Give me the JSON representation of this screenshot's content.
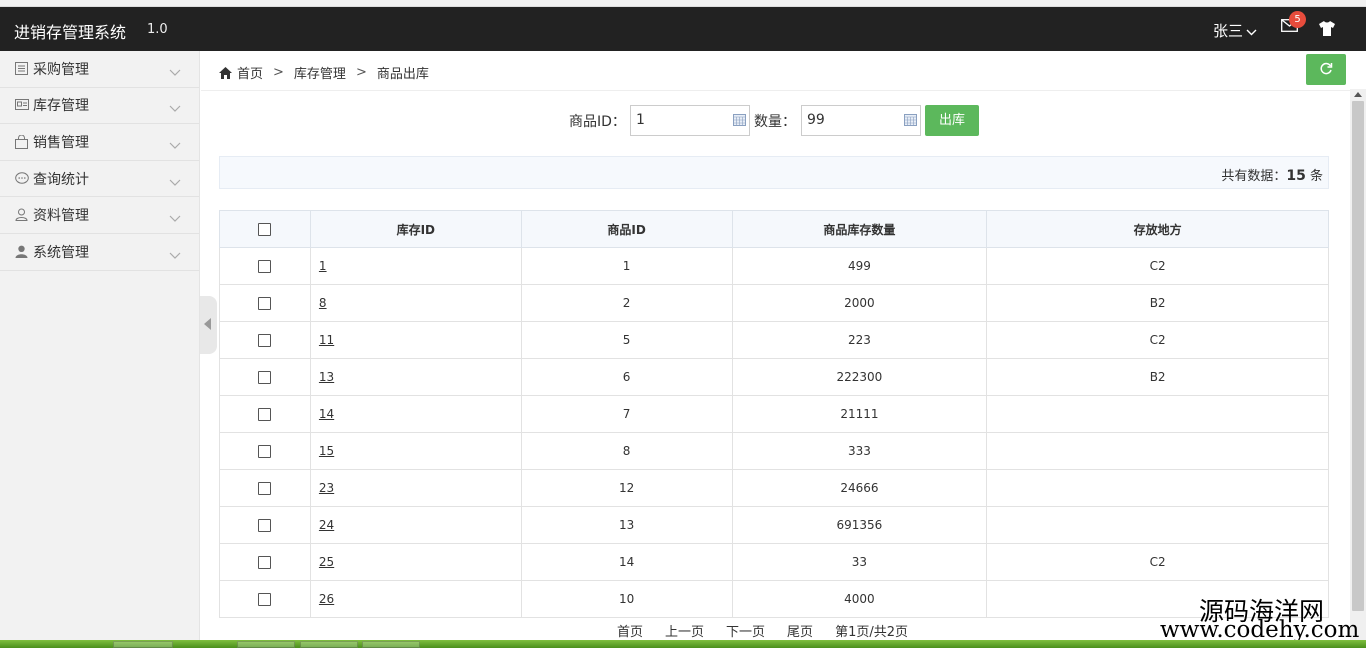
{
  "app": {
    "title": "进销存管理系统",
    "version": "1.0"
  },
  "header": {
    "user": "张三",
    "mail_badge": "5"
  },
  "sidebar": {
    "items": [
      {
        "label": "采购管理",
        "icon": "list-icon"
      },
      {
        "label": "库存管理",
        "icon": "card-icon"
      },
      {
        "label": "销售管理",
        "icon": "bag-icon"
      },
      {
        "label": "查询统计",
        "icon": "chat-icon"
      },
      {
        "label": "资料管理",
        "icon": "user-outline-icon"
      },
      {
        "label": "系统管理",
        "icon": "user-solid-icon"
      }
    ]
  },
  "breadcrumb": {
    "home": "首页",
    "section": "库存管理",
    "page": "商品出库"
  },
  "form": {
    "product_id_label": "商品ID：",
    "product_id_value": "1",
    "qty_label": "数量：",
    "qty_value": "99",
    "submit_label": "出库"
  },
  "summary": {
    "prefix": "共有数据：",
    "count": "15",
    "suffix": " 条"
  },
  "table": {
    "headers": [
      "库存ID",
      "商品ID",
      "商品库存数量",
      "存放地方"
    ],
    "rows": [
      {
        "stock_id": "1",
        "product_id": "1",
        "qty": "499",
        "location": "C2"
      },
      {
        "stock_id": "8",
        "product_id": "2",
        "qty": "2000",
        "location": "B2"
      },
      {
        "stock_id": "11",
        "product_id": "5",
        "qty": "223",
        "location": "C2"
      },
      {
        "stock_id": "13",
        "product_id": "6",
        "qty": "222300",
        "location": "B2"
      },
      {
        "stock_id": "14",
        "product_id": "7",
        "qty": "21111",
        "location": ""
      },
      {
        "stock_id": "15",
        "product_id": "8",
        "qty": "333",
        "location": ""
      },
      {
        "stock_id": "23",
        "product_id": "12",
        "qty": "24666",
        "location": ""
      },
      {
        "stock_id": "24",
        "product_id": "13",
        "qty": "691356",
        "location": ""
      },
      {
        "stock_id": "25",
        "product_id": "14",
        "qty": "33",
        "location": "C2"
      },
      {
        "stock_id": "26",
        "product_id": "10",
        "qty": "4000",
        "location": ""
      }
    ]
  },
  "pager": {
    "first": "首页",
    "prev": "上一页",
    "next": "下一页",
    "last": "尾页",
    "info": "第1页/共2页"
  },
  "watermark": {
    "line1": "源码海洋网",
    "line2": "www.codehy.com"
  },
  "colors": {
    "header_bg": "#222222",
    "accent_green": "#5cb85c",
    "badge_red": "#e74c3c"
  }
}
